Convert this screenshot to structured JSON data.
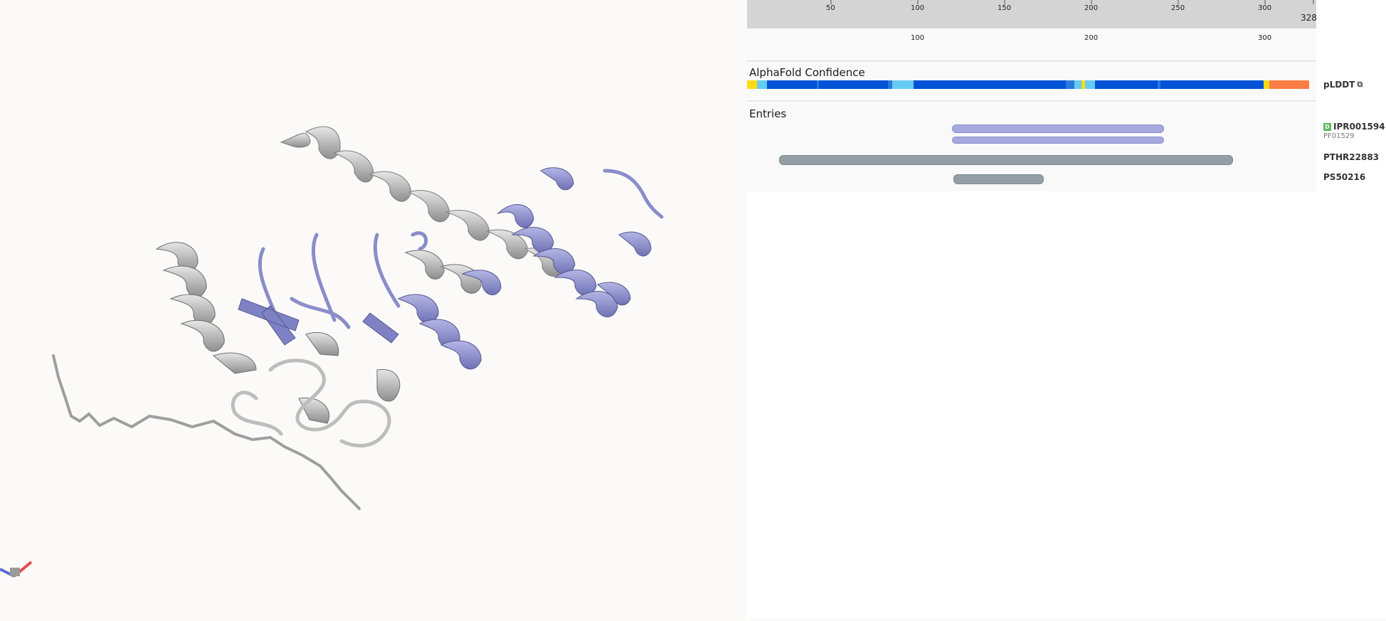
{
  "ruler": {
    "ticks": [
      "50",
      "100",
      "150",
      "200",
      "250",
      "300"
    ],
    "end_label": "328",
    "sub_ticks": [
      "100",
      "200",
      "300"
    ]
  },
  "confidence": {
    "title": "AlphaFold Confidence",
    "label": "pLDDT",
    "link_icon": "external-link-icon",
    "colors": {
      "very_high": "#0053d6",
      "high": "#65cbf3",
      "low": "#ffdb13",
      "very_low": "#ff7d45"
    }
  },
  "entries": {
    "title": "Entries",
    "items": [
      {
        "badge": "D",
        "accession": "IPR001594",
        "member": "PF01529",
        "color": "#9c9fd8"
      },
      {
        "accession": "PTHR22883",
        "color": "#8a959b"
      },
      {
        "accession": "PS50216",
        "color": "#8a959b"
      }
    ]
  },
  "structure": {
    "highlight_color": "#9699cc",
    "base_color": "#c9c9c9"
  }
}
